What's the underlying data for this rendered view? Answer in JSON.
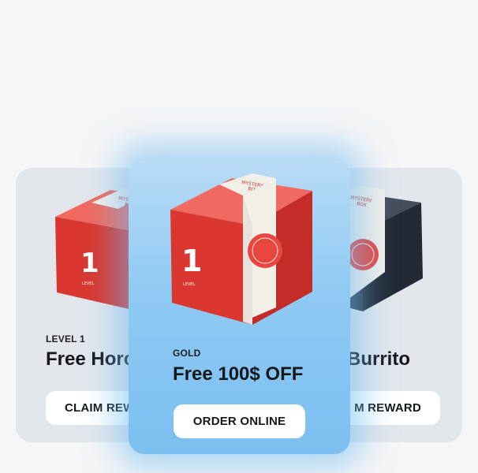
{
  "cards": [
    {
      "eyebrow": "LEVEL 1",
      "title": "Free Horc",
      "button": "CLAIM REW",
      "box": {
        "color": "#e8463f",
        "level_digit": "1",
        "level_word": "LEVEL",
        "label_line1": "MYSTERY",
        "label_line2": "BOX"
      }
    },
    {
      "eyebrow": "GOLD",
      "title": "Free 100$ OFF",
      "button": "ORDER ONLINE",
      "box": {
        "color": "#e8463f",
        "level_digit": "1",
        "level_word": "LEVEL",
        "label_line1": "MYSTERY",
        "label_line2": "BOX"
      }
    },
    {
      "eyebrow": "",
      "title": "Burrito",
      "button": "M REWARD",
      "box": {
        "color": "#2b3340",
        "label_line1": "MYSTERY",
        "label_line2": "BOX"
      }
    }
  ],
  "colors": {
    "accent": "#7bbff0",
    "side_card_bg": "#e3e7ec",
    "box_red": "#e8463f",
    "box_navy": "#2b3340"
  }
}
